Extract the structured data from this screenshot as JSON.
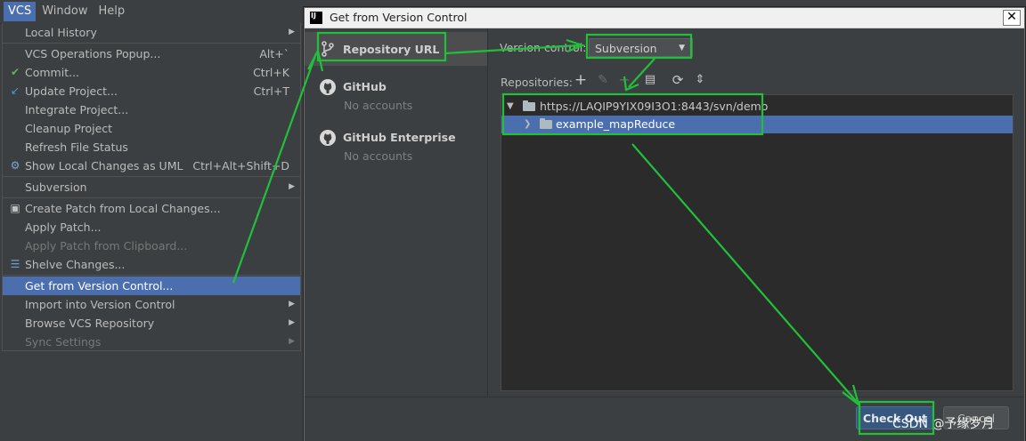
{
  "menubar": {
    "items": [
      {
        "label": "VCS",
        "active": true
      },
      {
        "label": "Window",
        "active": false
      },
      {
        "label": "Help",
        "active": false
      }
    ]
  },
  "vcs_menu": {
    "groups": [
      [
        {
          "label": "Local History",
          "arrow": true
        }
      ],
      [
        {
          "label": "VCS Operations Popup...",
          "shortcut": "Alt+`"
        },
        {
          "label": "Commit...",
          "shortcut": "Ctrl+K",
          "icon": "check-icon"
        },
        {
          "label": "Update Project...",
          "shortcut": "Ctrl+T",
          "icon": "update-arrow-icon"
        },
        {
          "label": "Integrate Project..."
        },
        {
          "label": "Cleanup Project"
        },
        {
          "label": "Refresh File Status"
        },
        {
          "label": "Show Local Changes as UML",
          "shortcut": "Ctrl+Alt+Shift+D",
          "icon": "uml-icon"
        }
      ],
      [
        {
          "label": "Subversion",
          "arrow": true
        }
      ],
      [
        {
          "label": "Create Patch from Local Changes...",
          "icon": "patch-icon"
        },
        {
          "label": "Apply Patch..."
        },
        {
          "label": "Apply Patch from Clipboard...",
          "disabled": true
        },
        {
          "label": "Shelve Changes...",
          "icon": "shelve-icon"
        }
      ],
      [
        {
          "label": "Get from Version Control...",
          "selected": true
        },
        {
          "label": "Import into Version Control",
          "arrow": true
        },
        {
          "label": "Browse VCS Repository",
          "arrow": true
        },
        {
          "label": "Sync Settings",
          "arrow": true,
          "disabled": true
        }
      ]
    ]
  },
  "dialog": {
    "title": "Get from Version Control",
    "close_glyph": "✕",
    "logo_text": "IJ",
    "sidebar": [
      {
        "name": "Repository URL",
        "sub": "",
        "icon": "branch-icon",
        "selected": true
      },
      {
        "name": "GitHub",
        "sub": "No accounts",
        "icon": "github-icon",
        "selected": false
      },
      {
        "name": "GitHub Enterprise",
        "sub": "No accounts",
        "icon": "github-icon",
        "selected": false
      }
    ],
    "version_control_label": "Version control:",
    "version_control_value": "Subversion",
    "repositories_label": "Repositories:",
    "tree": [
      {
        "label": "https://LAQIP9YIX09I3O1:8443/svn/demo",
        "expanded": true,
        "selected": false
      },
      {
        "label": "example_mapReduce",
        "expanded": false,
        "selected": true
      }
    ],
    "checkout_label": "Check Out",
    "cancel_label": "Cancel"
  },
  "watermark": "CSDN @予缘岁月",
  "annotation_color": "#22c03a"
}
